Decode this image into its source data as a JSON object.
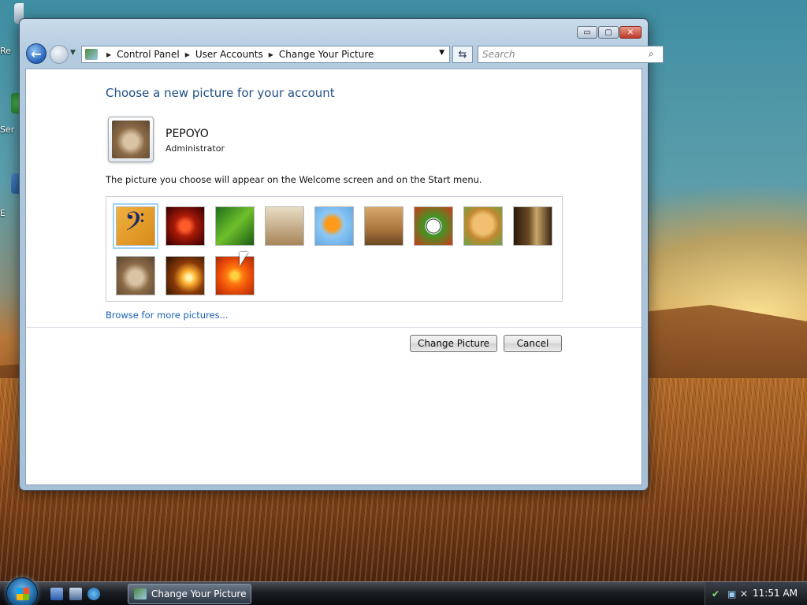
{
  "desktop": {
    "icons": [
      {
        "label": "Re"
      },
      {
        "label": "Ser"
      },
      {
        "label": "E"
      }
    ]
  },
  "window": {
    "caption_buttons": {
      "minimize": "▭",
      "restore": "▢",
      "close": "✕"
    },
    "nav": {
      "breadcrumb": [
        "Control Panel",
        "User Accounts",
        "Change Your Picture"
      ],
      "search_placeholder": "Search"
    },
    "content": {
      "title": "Choose a new picture for your account",
      "user": {
        "name": "PEPOYO",
        "role": "Administrator"
      },
      "description": "The picture you choose will appear on the Welcome screen and on the Start menu.",
      "pictures": [
        {
          "name": "music",
          "selected": true
        },
        {
          "name": "starfish"
        },
        {
          "name": "leaf"
        },
        {
          "name": "robot"
        },
        {
          "name": "fish"
        },
        {
          "name": "bonsai"
        },
        {
          "name": "soccer"
        },
        {
          "name": "dog"
        },
        {
          "name": "chess"
        },
        {
          "name": "kitten"
        },
        {
          "name": "sparkles"
        },
        {
          "name": "flower"
        }
      ],
      "browse_link": "Browse for more pictures...",
      "buttons": {
        "change": "Change Picture",
        "cancel": "Cancel"
      }
    }
  },
  "taskbar": {
    "active_window": "Change Your Picture",
    "clock": "11:51 AM"
  }
}
